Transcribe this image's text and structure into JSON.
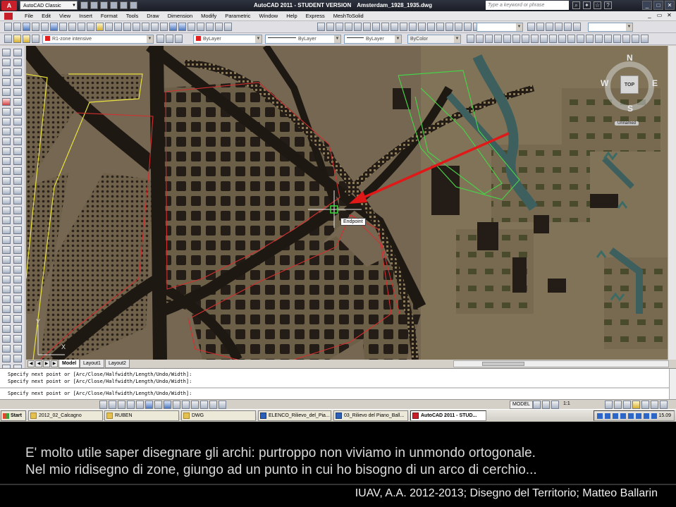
{
  "window": {
    "title": "AutoCAD 2011 - STUDENT VERSION",
    "document": "Amsterdam_1928_1935.dwg",
    "workspace": "AutoCAD Classic",
    "search_placeholder": "Type a keyword or phrase"
  },
  "menu": [
    "File",
    "Edit",
    "View",
    "Insert",
    "Format",
    "Tools",
    "Draw",
    "Dimension",
    "Modify",
    "Parametric",
    "Window",
    "Help",
    "Express",
    "MeshToSolid"
  ],
  "properties_bar": {
    "layer": "R1-zone intensive",
    "color": "ByLayer",
    "linetype": "ByLayer",
    "lineweight": "ByLayer",
    "plotstyle": "ByColor"
  },
  "viewcube": {
    "north": "N",
    "south": "S",
    "east": "E",
    "west": "W",
    "face": "TOP",
    "ucs": "Unnamed"
  },
  "ucs_icon": {
    "x": "X",
    "y": "Y"
  },
  "osnap_tooltip": "Endpoint",
  "layout_tabs": [
    "Model",
    "Layout1",
    "Layout2"
  ],
  "command_history": [
    "Specify next point or [Arc/Close/Halfwidth/Length/Undo/Width]:",
    "Specify next point or [Arc/Close/Halfwidth/Length/Undo/Width]:",
    "Specify next point or [Arc/Close/Halfwidth/Length/Undo/Width]:"
  ],
  "statusbar": {
    "space": "MODEL",
    "scale": "1:1"
  },
  "taskbar": {
    "start": "Start",
    "buttons": [
      "2012_02_Calcagno",
      "RUBEN",
      "DWG",
      "ELENCO_Rilievo_del_Pia...",
      "03_Rilievo del Piano_Ball...",
      "AutoCAD 2011 - STUD..."
    ],
    "clock": "15.09"
  },
  "caption": {
    "line1": "E' molto utile saper disegnare gli archi: purtroppo non viviamo in unmondo ortogonale.",
    "line2": "Nel mio ridisegno di zone, giungo ad un punto in cui ho bisogno di un arco di cerchio...",
    "footer": "IUAV, A.A. 2012-2013; Disegno del Territorio; Matteo Ballarin"
  },
  "colors": {
    "map_background": "#7a6c52",
    "building_dark": "#241d17",
    "zone_red": "#d23030",
    "zone_yellow": "#e8e040",
    "zone_green": "#48d048",
    "arrow_red": "#e01818",
    "water": "#3d5f5e"
  }
}
